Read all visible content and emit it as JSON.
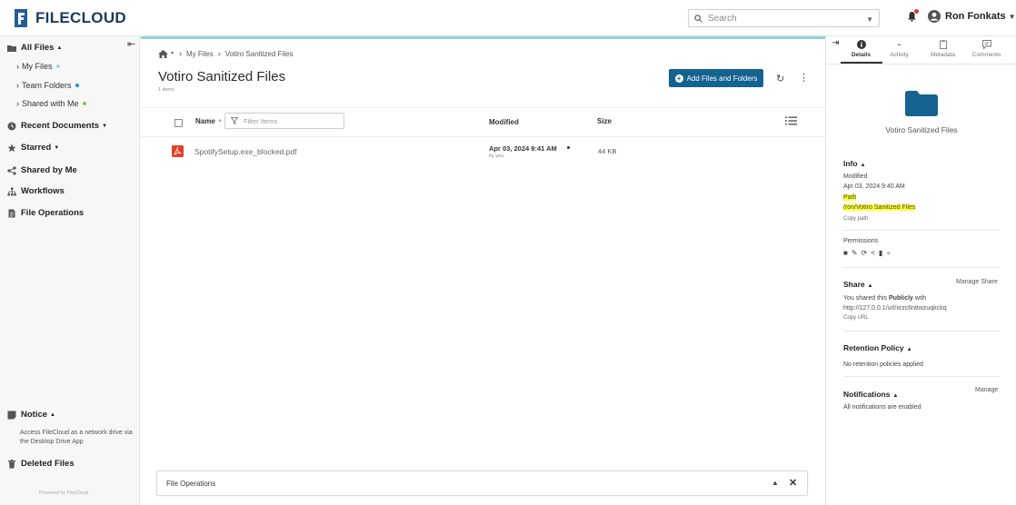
{
  "app": {
    "logo_text": "FILECLOUD",
    "brand_color": "#14628f"
  },
  "header": {
    "search_placeholder": "Search",
    "user_name": "Ron Fonkats"
  },
  "sidebar": {
    "all_files": "All Files",
    "sub_items": [
      {
        "label": "My Files",
        "dot_color": "#9adbe4"
      },
      {
        "label": "Team Folders",
        "dot_color": "#2a8bd6"
      },
      {
        "label": "Shared with Me",
        "dot_color": "#8bc34a"
      }
    ],
    "recent": "Recent Documents",
    "starred": "Starred",
    "shared_by_me": "Shared by Me",
    "workflows": "Workflows",
    "file_operations": "File Operations",
    "notice": "Notice",
    "notice_text": "Access FileCloud as a network drive via the Desktop Drive App",
    "deleted_files": "Deleted Files",
    "powered_by": "Powered by FileCloud"
  },
  "main": {
    "breadcrumb": [
      "My Files",
      "Votiro Sanitized Files"
    ],
    "title": "Votiro Sanitized Files",
    "item_count": "1 items",
    "add_button": "Add Files and Folders",
    "columns": {
      "name": "Name",
      "filter_placeholder": "Filter Items",
      "modified": "Modified",
      "size": "Size"
    },
    "files": [
      {
        "name": "SpotifySetup.exe_blocked.pdf",
        "modified": "Apr 03, 2024 9:41 AM",
        "by": "by you",
        "size": "44 KB"
      }
    ],
    "file_operations_bar": "File Operations"
  },
  "details": {
    "tabs": [
      "Details",
      "Activity",
      "Metadata",
      "Comments"
    ],
    "folder_name": "Votiro Sanitized Files",
    "info_title": "Info",
    "modified_label": "Modified",
    "modified_value": "Apr 03, 2024 9:40 AM",
    "path_label": "Path",
    "path_value": "/ron/Votiro Sanitized Files",
    "copy_path": "Copy path",
    "permissions_label": "Permissions",
    "share_title": "Share",
    "manage_share": "Manage Share",
    "share_text_prefix": "You shared this",
    "share_text_bold": "Publicly",
    "share_text_suffix": "with",
    "share_url": "http://127.0.0.1/url/xrzc6nttwzuqkckq",
    "copy_url": "Copy URL",
    "retention_title": "Retention Policy",
    "retention_text": "No retention policies applied",
    "notifications_title": "Notifications",
    "manage": "Manage",
    "notifications_text": "All notifications are enabled"
  }
}
